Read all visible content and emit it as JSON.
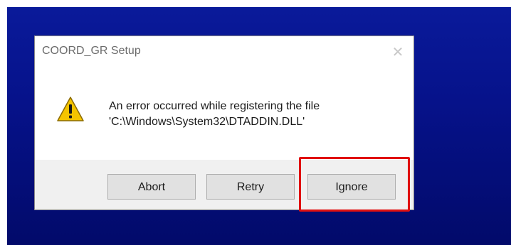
{
  "dialog": {
    "title": "COORD_GR Setup",
    "close_glyph": "✕",
    "message_line1": "An error occurred while registering the file",
    "message_line2": "'C:\\Windows\\System32\\DTADDIN.DLL'",
    "icon": "warning-icon"
  },
  "buttons": {
    "abort": "Abort",
    "retry": "Retry",
    "ignore": "Ignore"
  },
  "colors": {
    "desktop_background": "#06128a",
    "highlight": "#e01010",
    "warning_yellow": "#f5c400"
  }
}
